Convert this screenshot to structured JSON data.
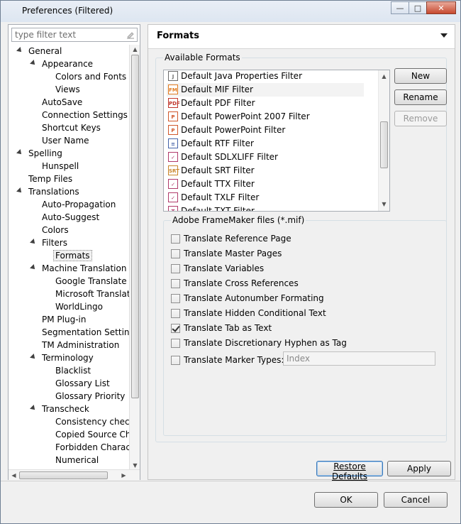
{
  "window": {
    "title": "Preferences (Filtered)",
    "controls": {
      "minimize": "—",
      "maximize": "□",
      "close": "✕"
    }
  },
  "filter": {
    "placeholder": "type filter text",
    "value": ""
  },
  "tree": [
    {
      "label": "General",
      "level": 0,
      "expanded": true
    },
    {
      "label": "Appearance",
      "level": 1,
      "expanded": true
    },
    {
      "label": "Colors and Fonts",
      "level": 2
    },
    {
      "label": "Views",
      "level": 2
    },
    {
      "label": "AutoSave",
      "level": 1
    },
    {
      "label": "Connection Settings",
      "level": 1
    },
    {
      "label": "Shortcut Keys",
      "level": 1
    },
    {
      "label": "User Name",
      "level": 1
    },
    {
      "label": "Spelling",
      "level": 0,
      "expanded": true
    },
    {
      "label": "Hunspell",
      "level": 1
    },
    {
      "label": "Temp Files",
      "level": 0
    },
    {
      "label": "Translations",
      "level": 0,
      "expanded": true
    },
    {
      "label": "Auto-Propagation",
      "level": 1
    },
    {
      "label": "Auto-Suggest",
      "level": 1
    },
    {
      "label": "Colors",
      "level": 1
    },
    {
      "label": "Filters",
      "level": 1,
      "expanded": true
    },
    {
      "label": "Formats",
      "level": 2,
      "selected": true
    },
    {
      "label": "Machine Translation",
      "level": 1,
      "expanded": true
    },
    {
      "label": "Google Translate",
      "level": 2
    },
    {
      "label": "Microsoft Translate",
      "level": 2
    },
    {
      "label": "WorldLingo",
      "level": 2
    },
    {
      "label": "PM Plug-in",
      "level": 1
    },
    {
      "label": "Segmentation Settings",
      "level": 1
    },
    {
      "label": "TM Administration",
      "level": 1
    },
    {
      "label": "Terminology",
      "level": 1,
      "expanded": true
    },
    {
      "label": "Blacklist",
      "level": 2
    },
    {
      "label": "Glossary List",
      "level": 2
    },
    {
      "label": "Glossary Priority",
      "level": 2
    },
    {
      "label": "Transcheck",
      "level": 1,
      "expanded": true
    },
    {
      "label": "Consistency check",
      "level": 2
    },
    {
      "label": "Copied Source Che",
      "level": 2
    },
    {
      "label": "Forbidden Characte",
      "level": 2
    },
    {
      "label": "Numerical",
      "level": 2
    }
  ],
  "page": {
    "title": "Formats",
    "available_formats_label": "Available Formats",
    "formats": [
      {
        "label": "Default Java Properties Filter",
        "icon": "java-file-icon",
        "glyph": "J",
        "color": "#6b6b6b"
      },
      {
        "label": "Default MIF Filter",
        "icon": "framemaker-icon",
        "glyph": "FM",
        "color": "#e07a1f",
        "selected": true
      },
      {
        "label": "Default PDF Filter",
        "icon": "pdf-icon",
        "glyph": "PDF",
        "color": "#c0352b"
      },
      {
        "label": "Default PowerPoint 2007 Filter",
        "icon": "powerpoint-2007-icon",
        "glyph": "P",
        "color": "#d0582c"
      },
      {
        "label": "Default PowerPoint Filter",
        "icon": "powerpoint-icon",
        "glyph": "P",
        "color": "#d0582c"
      },
      {
        "label": "Default RTF Filter",
        "icon": "rtf-icon",
        "glyph": "≡",
        "color": "#4563a8"
      },
      {
        "label": "Default SDLXLIFF Filter",
        "icon": "sdlxliff-icon",
        "glyph": "✓",
        "color": "#b03a6b"
      },
      {
        "label": "Default SRT Filter",
        "icon": "srt-icon",
        "glyph": "SRT",
        "color": "#c9852a"
      },
      {
        "label": "Default TTX Filter",
        "icon": "ttx-icon",
        "glyph": "✓",
        "color": "#b03a6b"
      },
      {
        "label": "Default TXLF Filter",
        "icon": "txlf-icon",
        "glyph": "✓",
        "color": "#b03a6b"
      },
      {
        "label": "Default TXT Filter",
        "icon": "txt-icon",
        "glyph": "T",
        "color": "#b03a6b"
      }
    ],
    "buttons": {
      "new": "New",
      "rename": "Rename",
      "remove": "Remove"
    },
    "fm_group_label": "Adobe FrameMaker files (*.mif)",
    "options": [
      {
        "label": "Translate Reference Page",
        "checked": false
      },
      {
        "label": "Translate Master Pages",
        "checked": false
      },
      {
        "label": "Translate Variables",
        "checked": false
      },
      {
        "label": "Translate Cross References",
        "checked": false
      },
      {
        "label": "Translate Autonumber Formating",
        "checked": false
      },
      {
        "label": "Translate Hidden Conditional Text",
        "checked": false
      },
      {
        "label": "Translate Tab as Text",
        "checked": true
      },
      {
        "label": "Translate Discretionary Hyphen as Tag",
        "checked": false
      }
    ],
    "marker": {
      "label": "Translate Marker Types:",
      "checked": false,
      "value": "Index"
    },
    "restore_defaults": "Restore Defaults",
    "apply": "Apply"
  },
  "dialog": {
    "ok": "OK",
    "cancel": "Cancel"
  }
}
